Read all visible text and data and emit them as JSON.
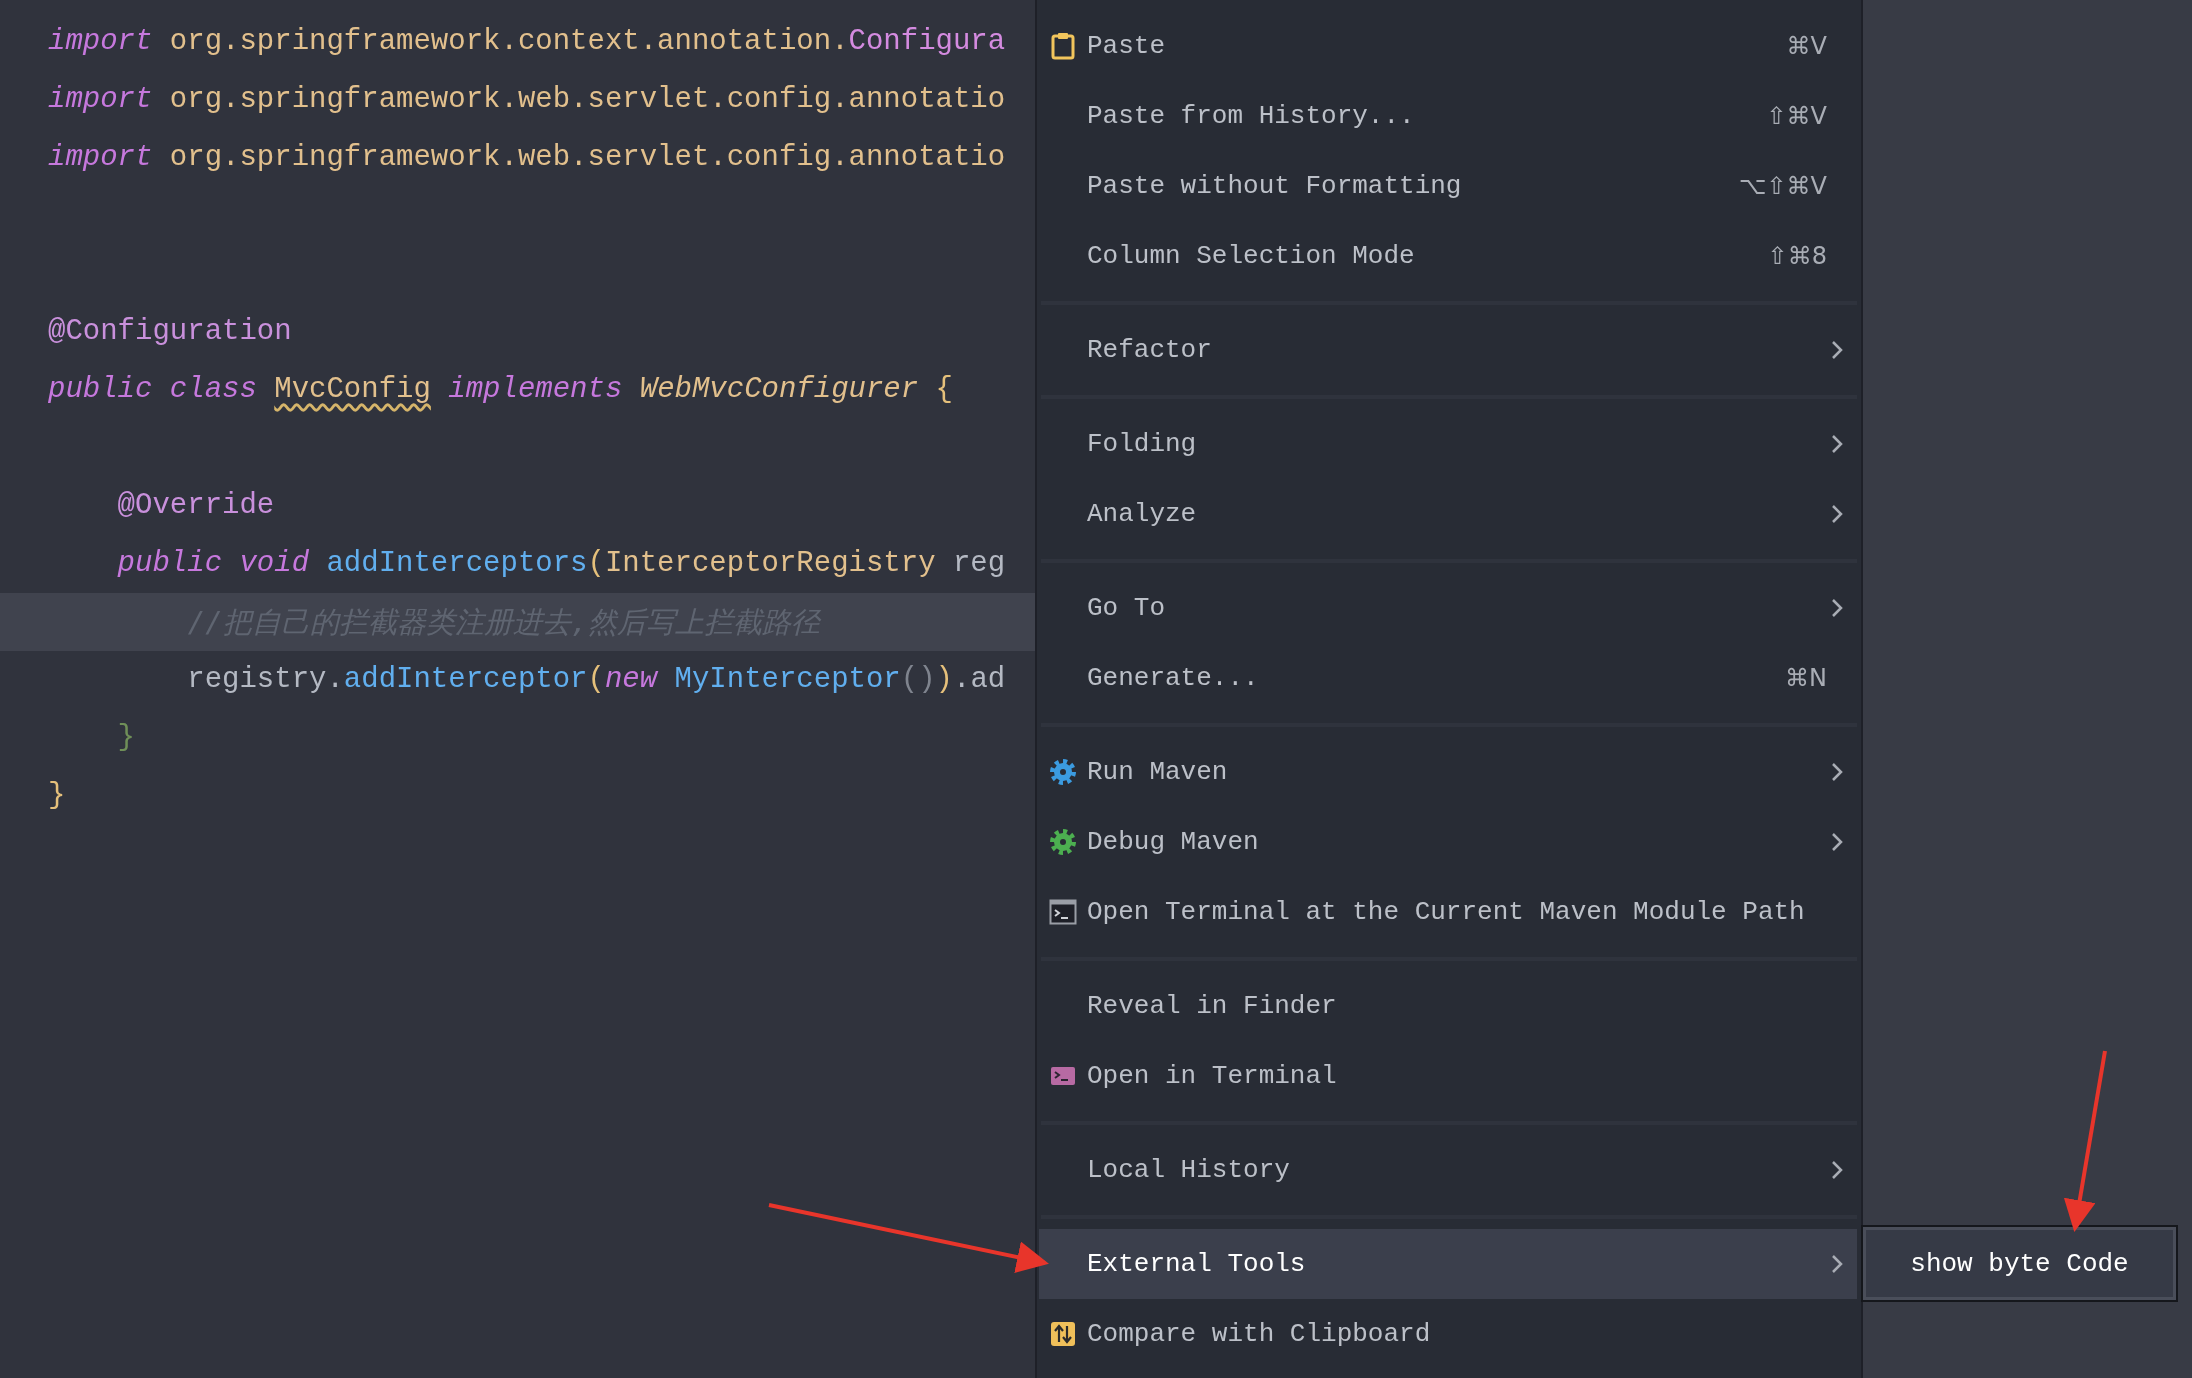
{
  "editor": {
    "lines": [
      {
        "kind": "code",
        "highlighted": false,
        "tokens": [
          {
            "text": "import",
            "kind": "keyword"
          },
          {
            "text": " org.springframework.context.annotation.",
            "kind": "package"
          },
          {
            "text": "Configura",
            "kind": "type-ref"
          }
        ]
      },
      {
        "kind": "code",
        "highlighted": false,
        "tokens": [
          {
            "text": "import",
            "kind": "keyword"
          },
          {
            "text": " org.springframework.web.servlet.config.annotatio",
            "kind": "package"
          }
        ]
      },
      {
        "kind": "code",
        "highlighted": false,
        "tokens": [
          {
            "text": "import",
            "kind": "keyword"
          },
          {
            "text": " org.springframework.web.servlet.config.annotatio",
            "kind": "package"
          }
        ]
      },
      {
        "kind": "blank",
        "highlighted": false
      },
      {
        "kind": "blank",
        "highlighted": false
      },
      {
        "kind": "code",
        "highlighted": false,
        "tokens": [
          {
            "text": "@Configuration",
            "kind": "annotation"
          }
        ]
      },
      {
        "kind": "code",
        "highlighted": false,
        "tokens": [
          {
            "text": "public class ",
            "kind": "keyword"
          },
          {
            "text": "MvcConfig",
            "kind": "class-warning"
          },
          {
            "text": " implements",
            "kind": "keyword"
          },
          {
            "text": " WebMvcConfigurer",
            "kind": "interface"
          },
          {
            "text": " {",
            "kind": "brace"
          }
        ]
      },
      {
        "kind": "blank",
        "highlighted": false
      },
      {
        "kind": "code",
        "highlighted": false,
        "tokens": [
          {
            "text": "    @Override",
            "kind": "annotation"
          }
        ]
      },
      {
        "kind": "code",
        "highlighted": false,
        "tokens": [
          {
            "text": "    public void",
            "kind": "keyword"
          },
          {
            "text": " addInterceptors",
            "kind": "method"
          },
          {
            "text": "(",
            "kind": "brace"
          },
          {
            "text": "InterceptorRegistry",
            "kind": "package"
          },
          {
            "text": " reg",
            "kind": "plain"
          }
        ]
      },
      {
        "kind": "code",
        "highlighted": true,
        "tokens": [
          {
            "text": "        //把自己的拦截器类注册进去,然后写上拦截路径",
            "kind": "comment"
          }
        ]
      },
      {
        "kind": "code",
        "highlighted": false,
        "tokens": [
          {
            "text": "        registry.",
            "kind": "plain"
          },
          {
            "text": "addInterceptor",
            "kind": "method"
          },
          {
            "text": "(",
            "kind": "brace"
          },
          {
            "text": "new",
            "kind": "keyword"
          },
          {
            "text": " MyInterceptor",
            "kind": "method"
          },
          {
            "text": "()",
            "kind": "paren-dim"
          },
          {
            "text": ")",
            "kind": "brace"
          },
          {
            "text": ".ad",
            "kind": "plain"
          }
        ]
      },
      {
        "kind": "code",
        "highlighted": false,
        "tokens": [
          {
            "text": "    }",
            "kind": "brace-nested"
          }
        ]
      },
      {
        "kind": "code",
        "highlighted": false,
        "tokens": [
          {
            "text": "}",
            "kind": "brace"
          }
        ]
      }
    ]
  },
  "context_menu": {
    "groups": [
      {
        "items": [
          {
            "label": "Paste",
            "kind": "clipboard",
            "shortcut": "⌘V",
            "submenu": false,
            "selected": false
          },
          {
            "label": "Paste from History...",
            "kind": "plain",
            "shortcut": "⇧⌘V",
            "submenu": false,
            "selected": false
          },
          {
            "label": "Paste without Formatting",
            "kind": "plain",
            "shortcut": "⌥⇧⌘V",
            "submenu": false,
            "selected": false
          },
          {
            "label": "Column Selection Mode",
            "kind": "plain",
            "shortcut": "⇧⌘8",
            "submenu": false,
            "selected": false
          }
        ]
      },
      {
        "items": [
          {
            "label": "Refactor",
            "kind": "plain",
            "submenu": true,
            "selected": false
          }
        ]
      },
      {
        "items": [
          {
            "label": "Folding",
            "kind": "plain",
            "submenu": true,
            "selected": false
          },
          {
            "label": "Analyze",
            "kind": "plain",
            "submenu": true,
            "selected": false
          }
        ]
      },
      {
        "items": [
          {
            "label": "Go To",
            "kind": "plain",
            "submenu": true,
            "selected": false
          },
          {
            "label": "Generate...",
            "kind": "plain",
            "shortcut": "⌘N",
            "submenu": false,
            "selected": false
          }
        ]
      },
      {
        "items": [
          {
            "label": "Run Maven",
            "kind": "gear-run",
            "submenu": true,
            "selected": false
          },
          {
            "label": "Debug Maven",
            "kind": "gear-debug",
            "submenu": true,
            "selected": false
          },
          {
            "label": "Open Terminal at the Current Maven Module Path",
            "kind": "terminal-window",
            "submenu": false,
            "selected": false
          }
        ]
      },
      {
        "items": [
          {
            "label": "Reveal in Finder",
            "kind": "plain",
            "submenu": false,
            "selected": false
          },
          {
            "label": "Open in Terminal",
            "kind": "terminal",
            "submenu": false,
            "selected": false
          }
        ]
      },
      {
        "items": [
          {
            "label": "Local History",
            "kind": "plain",
            "submenu": true,
            "selected": false
          }
        ]
      },
      {
        "items": [
          {
            "label": "External Tools",
            "kind": "plain",
            "submenu": true,
            "selected": true
          },
          {
            "label": "Compare with Clipboard",
            "kind": "compare",
            "submenu": false,
            "selected": false
          }
        ]
      }
    ]
  },
  "submenu": {
    "items": [
      {
        "label": "show byte Code",
        "selected": false
      }
    ]
  }
}
